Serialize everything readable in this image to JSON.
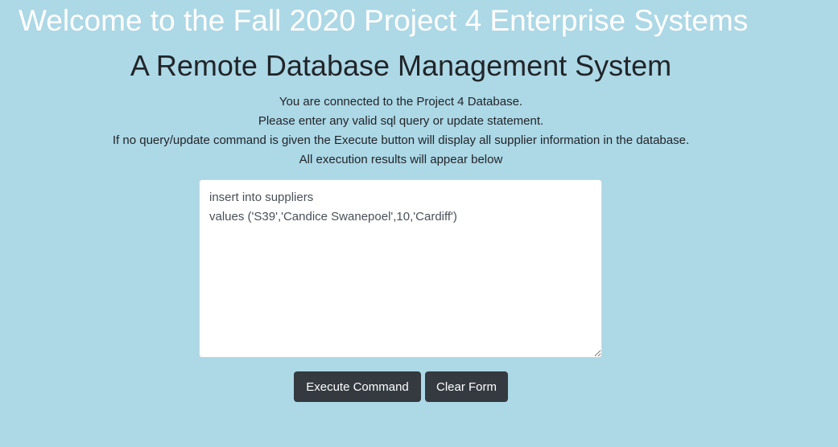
{
  "header": {
    "welcome": "Welcome to the Fall 2020 Project 4 Enterprise Systems",
    "subtitle": "A Remote Database Management System"
  },
  "info": {
    "lines": [
      "You are connected to the Project 4 Database.",
      "Please enter any valid sql query or update statement.",
      "If no query/update command is given the Execute button will display all supplier information in the database.",
      "All execution results will appear below"
    ]
  },
  "query": {
    "value": "insert into suppliers\nvalues ('S39','Candice Swanepoel',10,'Cardiff')"
  },
  "actions": {
    "execute_label": "Execute Command",
    "clear_label": "Clear Form"
  },
  "colors": {
    "background": "#add8e6",
    "button": "#343a40"
  }
}
